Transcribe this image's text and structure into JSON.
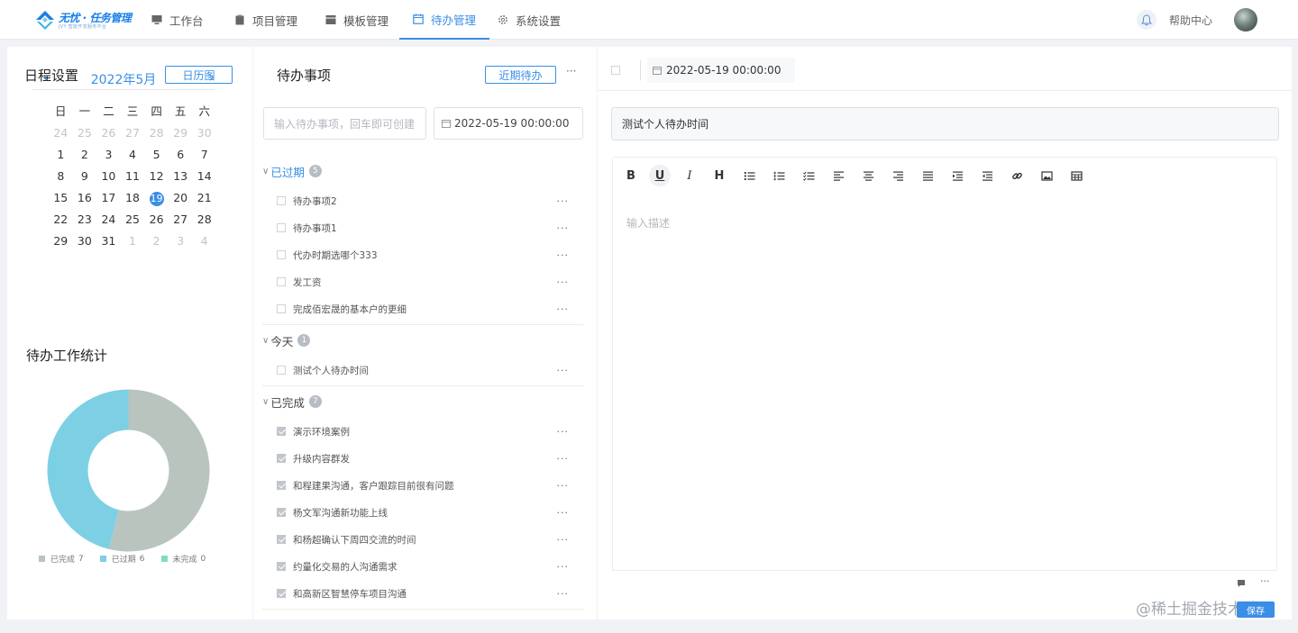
{
  "brand": {
    "name": "无忧 · 任务管理",
    "subtitle": "JVY 智能开发服务平台"
  },
  "nav": [
    {
      "label": "工作台",
      "icon": "monitor-icon"
    },
    {
      "label": "项目管理",
      "icon": "clipboard-icon"
    },
    {
      "label": "模板管理",
      "icon": "template-icon"
    },
    {
      "label": "待办管理",
      "icon": "calendar-icon",
      "active": true
    },
    {
      "label": "系统设置",
      "icon": "gear-icon"
    }
  ],
  "header": {
    "help": "帮助中心"
  },
  "schedule": {
    "title": "日程设置",
    "calendar_button": "日历图",
    "month_label": "2022年5月",
    "weekdays": [
      "日",
      "一",
      "二",
      "三",
      "四",
      "五",
      "六"
    ],
    "weeks": [
      [
        "24",
        "25",
        "26",
        "27",
        "28",
        "29",
        "30"
      ],
      [
        "1",
        "2",
        "3",
        "4",
        "5",
        "6",
        "7"
      ],
      [
        "8",
        "9",
        "10",
        "11",
        "12",
        "13",
        "14"
      ],
      [
        "15",
        "16",
        "17",
        "18",
        "19",
        "20",
        "21"
      ],
      [
        "22",
        "23",
        "24",
        "25",
        "26",
        "27",
        "28"
      ],
      [
        "29",
        "30",
        "31",
        "1",
        "2",
        "3",
        "4"
      ]
    ],
    "today": "19"
  },
  "stats": {
    "title": "待办工作统计",
    "legend": [
      {
        "label": "已完成",
        "count": "7",
        "color": "#b9c4bf"
      },
      {
        "label": "已过期",
        "count": "6",
        "color": "#7dd0e3"
      },
      {
        "label": "未完成",
        "count": "0",
        "color": "#80dcc0"
      }
    ],
    "chart_data": {
      "type": "pie",
      "categories": [
        "已完成",
        "已过期",
        "未完成"
      ],
      "values": [
        7,
        6,
        0
      ]
    }
  },
  "todos": {
    "title": "待办事项",
    "recent_button": "近期待办",
    "input_placeholder": "输入待办事项，回车即可创建",
    "date_value": "2022-05-19 00:00:00",
    "groups": [
      {
        "name": "已过期",
        "count": "5",
        "items": [
          "待办事项2",
          "待办事项1",
          "代办时期选哪个333",
          "发工资",
          "完成佰宏晟的基本户的更细"
        ],
        "checked": false
      },
      {
        "name": "今天",
        "count": "1",
        "items": [
          "测试个人待办时间"
        ],
        "checked": false
      },
      {
        "name": "已完成",
        "count": "7",
        "items": [
          "演示环境案例",
          "升级内容群发",
          "和程建果沟通，客户跟踪目前很有问题",
          "杨文军沟通新功能上线",
          "和杨超确认下周四交流的时间",
          "约量化交易的人沟通需求",
          "和高新区智慧停车项目沟通"
        ],
        "checked": true
      }
    ]
  },
  "detail": {
    "date_value": "2022-05-19 00:00:00",
    "title_value": "测试个人待办时间",
    "desc_placeholder": "输入描述",
    "toolbar": [
      "B",
      "U",
      "I",
      "H"
    ]
  },
  "watermark": "@稀土掘金技术社区",
  "save_label": "保存"
}
